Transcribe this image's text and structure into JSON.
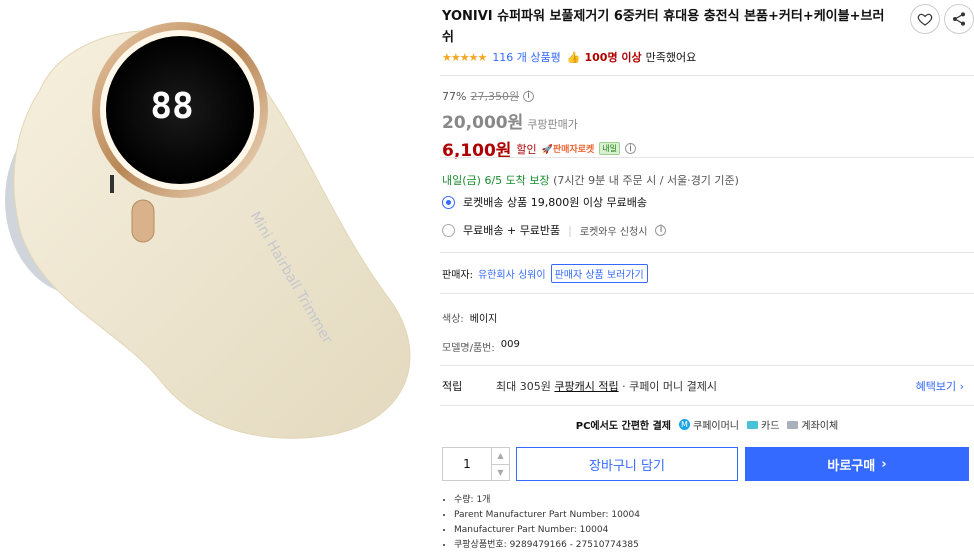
{
  "product": {
    "title": "YONIVI 슈퍼파워 보풀제거기 6중커터 휴대용 충전식 본품+커터+케이블+브러쉬",
    "image_text": "Mini Hairball Trimmer",
    "display_digits": "88"
  },
  "icons": {
    "wishlist": "heart-icon",
    "share": "share-icon"
  },
  "rating": {
    "stars": "★★★★★",
    "reviews": "116 개 상품평",
    "satisfied_count": "100명 이상",
    "satisfied_text": "만족했어요"
  },
  "price": {
    "discount_rate": "77%",
    "original_price": "27,350원",
    "base_price": "20,000원",
    "base_label": "쿠팡판매가",
    "sale_price": "6,100원",
    "sale_label": "할인",
    "seller_rocket": "🚀판매자로켓",
    "tomorrow_badge": "내일"
  },
  "delivery": {
    "date": "내일(금) 6/5",
    "guarantee": "도착 보장",
    "condition": "(7시간 9분 내 주문 시 / 서울⋅경기 기준)"
  },
  "options": [
    {
      "label": "로켓배송 상품 19,800원 이상 무료배송",
      "sub": "",
      "checked": true
    },
    {
      "label": "무료배송 + 무료반품",
      "sub": "로켓와우 신청시",
      "checked": false
    }
  ],
  "seller": {
    "label": "판매자:",
    "name": "유한회사 싱워이",
    "link": "판매자 상품 보러가기"
  },
  "attributes": {
    "color_key": "색상:",
    "color_value": "베이지",
    "model_key": "모델명/품번:",
    "model_value": "009"
  },
  "points": {
    "label": "적립",
    "prefix": "최대 305원",
    "cash": "쿠팡캐시 적립",
    "suffix": "· 쿠페이 머니 결제시",
    "benefit_link": "혜택보기 ›"
  },
  "payment": {
    "label": "PC에서도 간편한 결제",
    "methods": [
      "쿠페이머니",
      "카드",
      "계좌이체"
    ]
  },
  "purchase": {
    "quantity": "1",
    "cart_button": "장바구니 담기",
    "buy_button": "바로구매",
    "buy_arrow": "›"
  },
  "specs": [
    "수량: 1개",
    "Parent Manufacturer Part Number: 10004",
    "Manufacturer Part Number: 10004",
    "쿠팡상품번호: 9289479166 - 27510774385"
  ]
}
